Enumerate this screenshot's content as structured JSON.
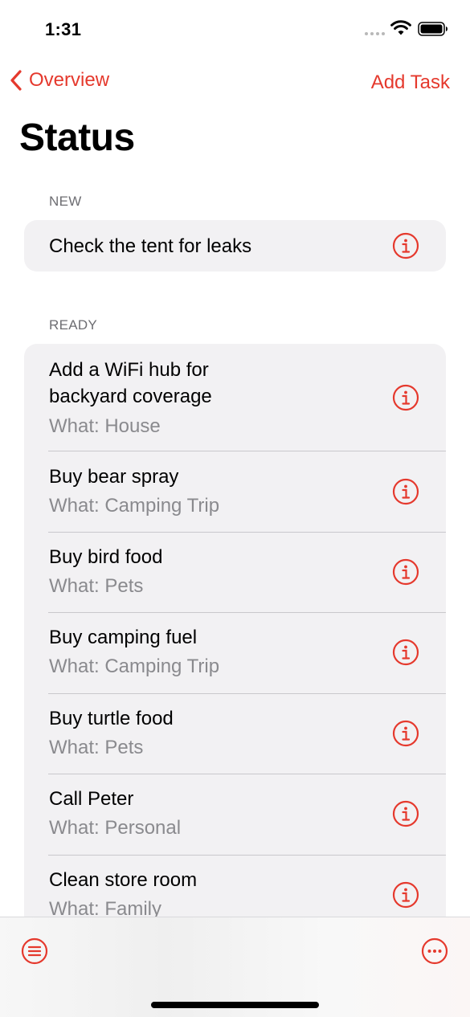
{
  "status_bar": {
    "time": "1:31"
  },
  "nav": {
    "back_label": "Overview",
    "add_label": "Add Task"
  },
  "page_title": "Status",
  "sections": [
    {
      "header": "NEW",
      "rows": [
        {
          "title": "Check the tent for leaks"
        }
      ]
    },
    {
      "header": "READY",
      "rows": [
        {
          "title": "Add a WiFi hub for backyard coverage",
          "subtitle": "What: House"
        },
        {
          "title": "Buy bear spray",
          "subtitle": "What: Camping Trip"
        },
        {
          "title": "Buy bird food",
          "subtitle": "What: Pets"
        },
        {
          "title": "Buy camping fuel",
          "subtitle": "What: Camping Trip"
        },
        {
          "title": "Buy turtle food",
          "subtitle": "What: Pets"
        },
        {
          "title": "Call Peter",
          "subtitle": "What: Personal"
        },
        {
          "title": "Clean store room",
          "subtitle": "What: Family"
        }
      ]
    }
  ],
  "colors": {
    "accent": "#e5392d",
    "group_bg": "#f2f1f3",
    "secondary_text": "#8a8a8e"
  },
  "icons": {
    "row_action": "info-circle-icon",
    "toolbar_left": "list-circle-icon",
    "toolbar_right": "ellipsis-circle-icon"
  }
}
